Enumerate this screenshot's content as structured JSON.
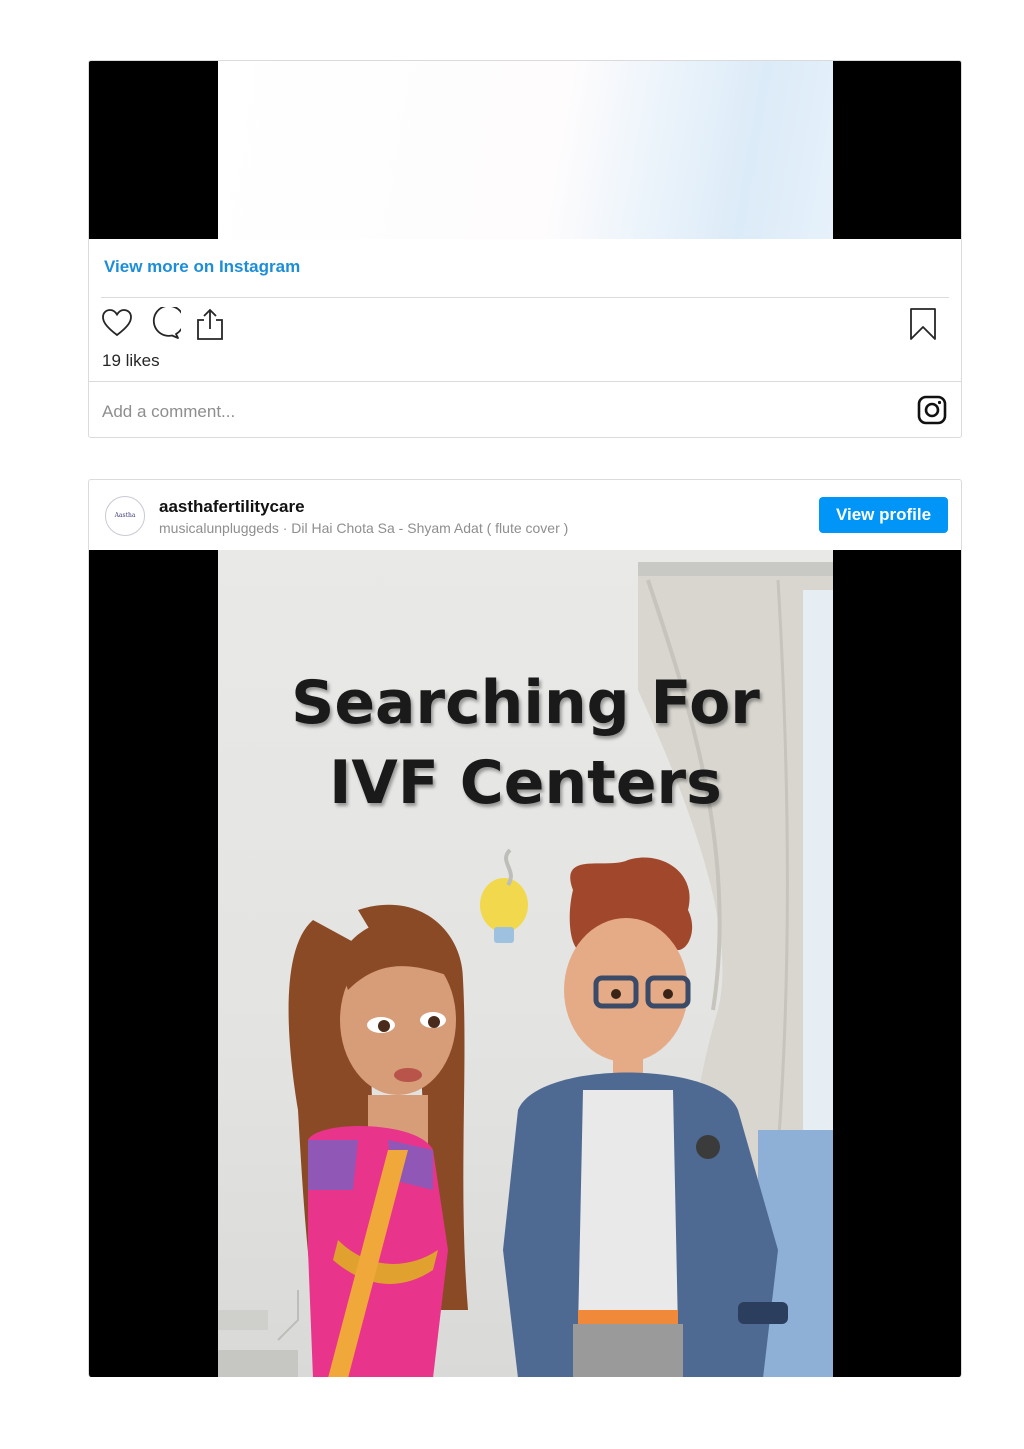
{
  "embed1": {
    "view_more": "View more on Instagram",
    "likes": "19 likes",
    "comment_placeholder": "Add a comment...",
    "icons": [
      "heart-icon",
      "comment-icon",
      "share-icon",
      "bookmark-icon",
      "instagram-icon"
    ]
  },
  "embed2": {
    "username": "aasthafertilitycare",
    "subline": "musicalunpluggeds · Dil Hai Chota Sa - Shyam Adat ( flute cover )",
    "avatar_text": "Aastha",
    "view_profile": "View profile",
    "video_title_line1": "Searching For",
    "video_title_line2": "IVF Centers"
  },
  "colors": {
    "link_blue": "#1c8ed9",
    "button_blue": "#0095f6",
    "border": "#dbdbdb"
  }
}
